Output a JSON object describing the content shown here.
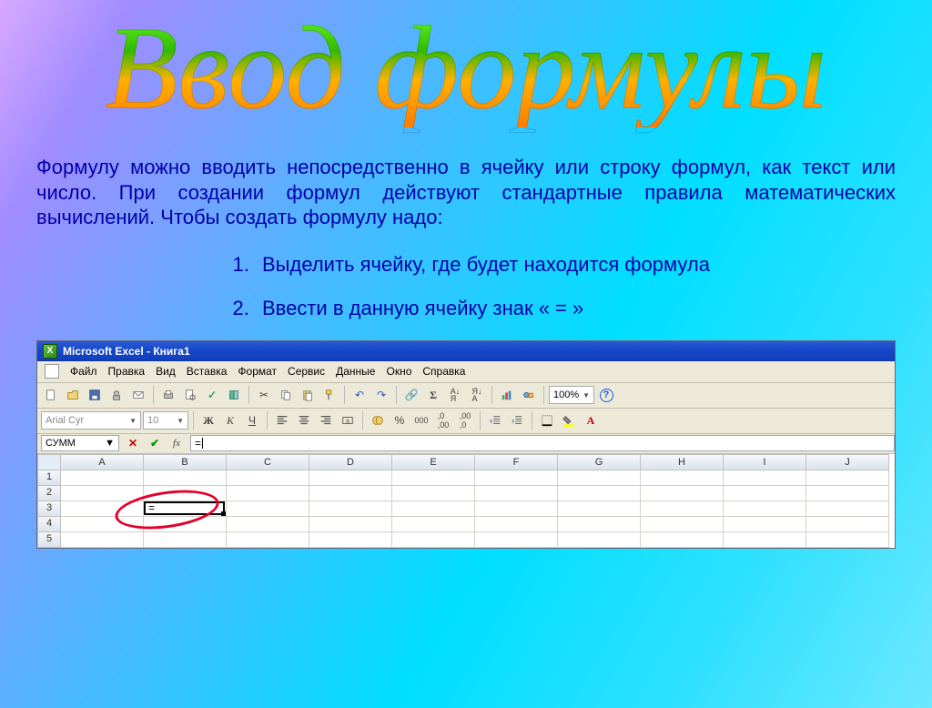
{
  "title": "Ввод формулы",
  "intro": "Формулу можно вводить непосредственно в ячейку или строку формул, как текст или число. При создании формул действуют стандартные правила математических вычислений. Чтобы создать формулу надо:",
  "steps": [
    "Выделить ячейку, где будет находится формула",
    "Ввести в данную ячейку знак « = »"
  ],
  "excel": {
    "title": "Microsoft Excel - Книга1",
    "menu": [
      "Файл",
      "Правка",
      "Вид",
      "Вставка",
      "Формат",
      "Сервис",
      "Данные",
      "Окно",
      "Справка"
    ],
    "toolbar1": {
      "zoom": "100%"
    },
    "toolbar2": {
      "font": "Arial Cyr",
      "size": "10",
      "btns": [
        "Ж",
        "К",
        "Ч"
      ]
    },
    "namebox": "СУММ",
    "fx": "fx",
    "formula": "=",
    "columns": [
      "A",
      "B",
      "C",
      "D",
      "E",
      "F",
      "G",
      "H",
      "I",
      "J"
    ],
    "rows": [
      "1",
      "2",
      "3",
      "4",
      "5"
    ],
    "active": {
      "col": "B",
      "row": "3",
      "value": "="
    }
  }
}
